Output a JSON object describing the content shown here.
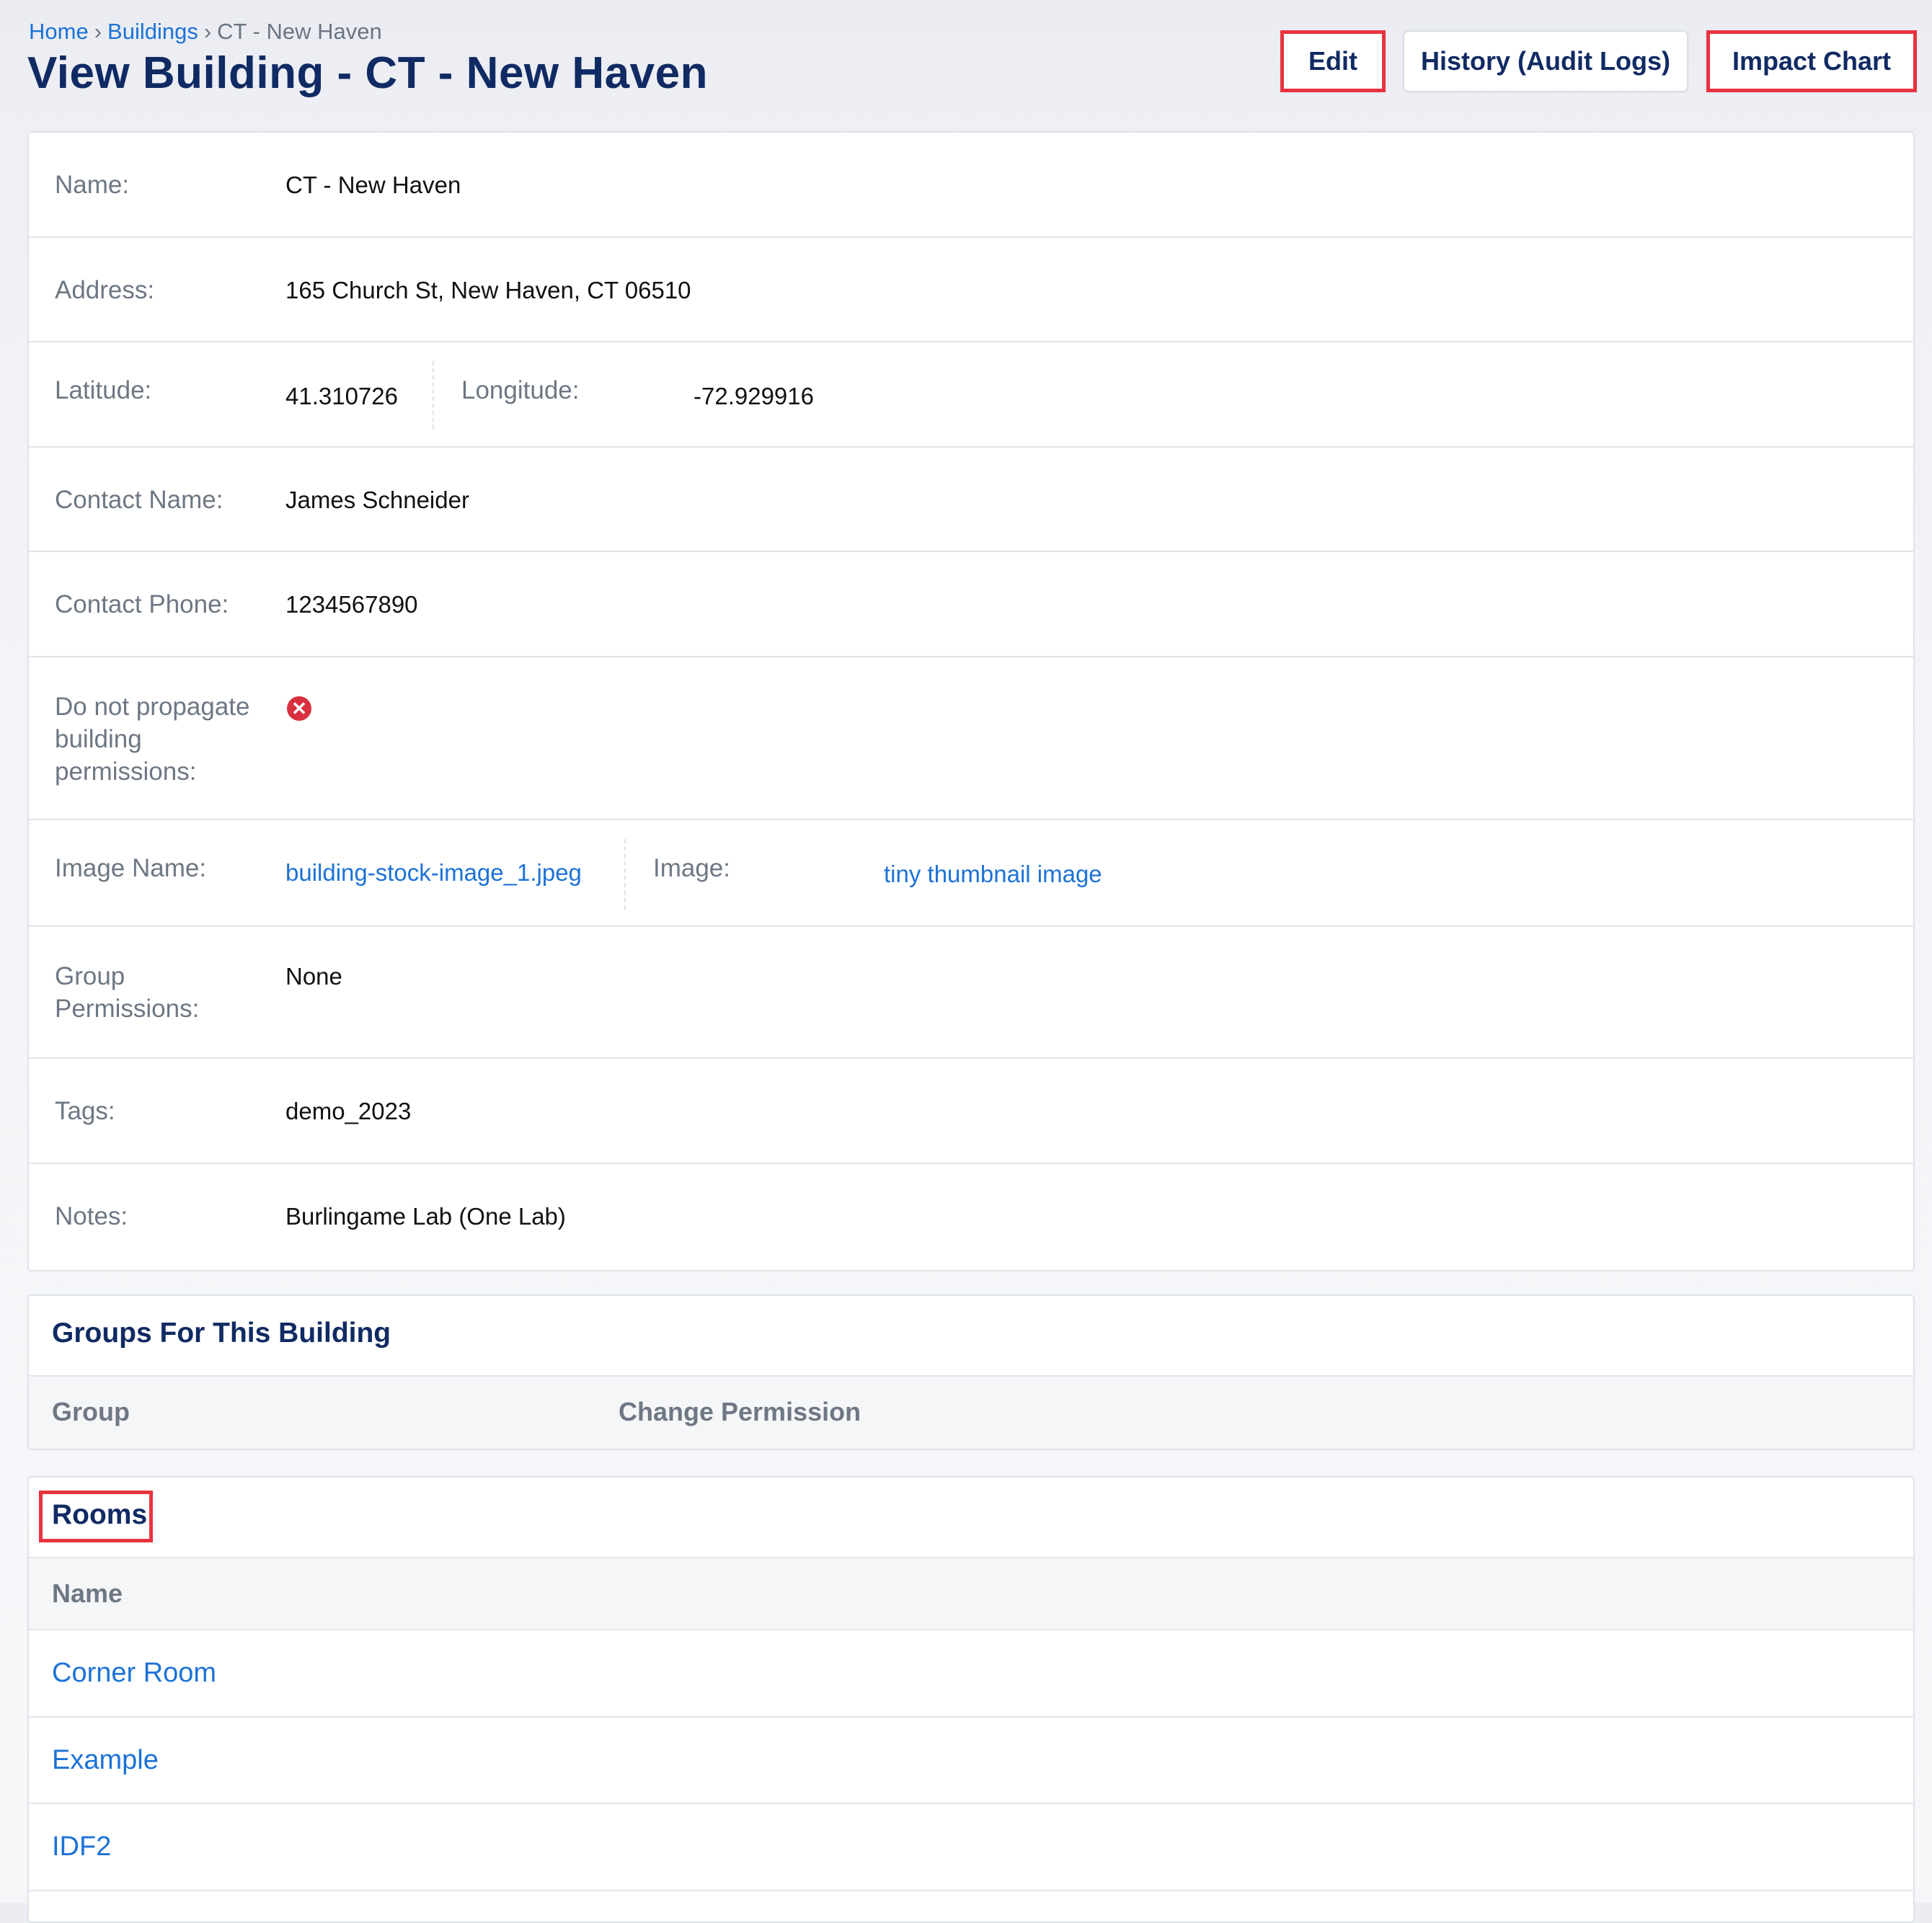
{
  "breadcrumb": {
    "home": "Home",
    "buildings": "Buildings",
    "current": "CT - New Haven",
    "separator": "›"
  },
  "page_title": "View Building - CT - New Haven",
  "actions": {
    "edit": "Edit",
    "history": "History (Audit Logs)",
    "impact_chart": "Impact Chart"
  },
  "details": {
    "name": {
      "label": "Name:",
      "value": "CT - New Haven"
    },
    "address": {
      "label": "Address:",
      "value": "165 Church St, New Haven, CT 06510"
    },
    "latitude": {
      "label": "Latitude:",
      "value": "41.310726"
    },
    "longitude": {
      "label": "Longitude:",
      "value": "-72.929916"
    },
    "contact_name": {
      "label": "Contact Name:",
      "value": "James Schneider"
    },
    "contact_phone": {
      "label": "Contact Phone:",
      "value": "1234567890"
    },
    "do_not_propagate": {
      "label_lines": [
        "Do not propagate",
        "building",
        "permissions:"
      ],
      "value_icon": "x-circle-icon",
      "value_color": "#d8303f"
    },
    "image_name": {
      "label": "Image Name:",
      "value": "building-stock-image_1.jpeg"
    },
    "image": {
      "label": "Image:",
      "value": "tiny thumbnail image"
    },
    "group_permissions": {
      "label_lines": [
        "Group",
        "Permissions:"
      ],
      "value": "None"
    },
    "tags": {
      "label": "Tags:",
      "value": "demo_2023"
    },
    "notes": {
      "label": "Notes:",
      "value": "Burlingame Lab (One Lab)"
    }
  },
  "groups_section": {
    "title": "Groups For This Building",
    "columns": [
      "Group",
      "Change Permission"
    ]
  },
  "rooms_section": {
    "title": "Rooms",
    "columns": [
      "Name"
    ],
    "rows": [
      "Corner Room",
      "Example",
      "IDF2"
    ]
  },
  "colors": {
    "accent_link": "#1c72d6",
    "title_navy": "#102a63",
    "highlight_red": "#e8333f",
    "error_red": "#d8303f"
  }
}
